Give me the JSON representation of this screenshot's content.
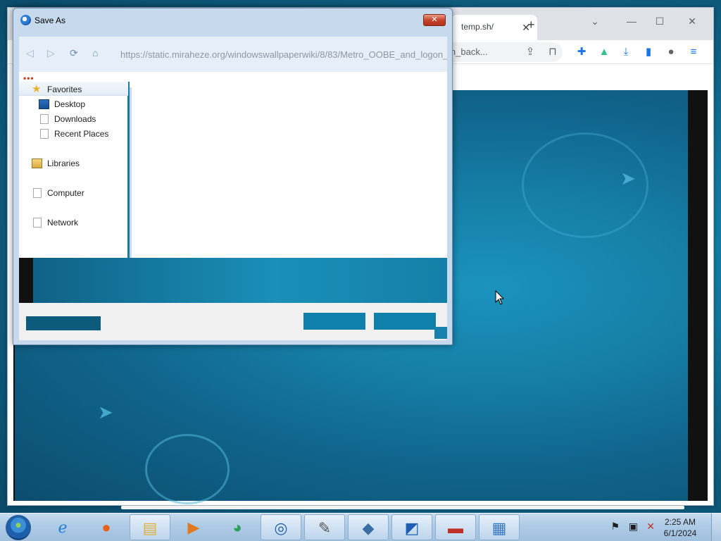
{
  "browser": {
    "tab_title": "temp.sh/",
    "address": "https://static.miraheze.org/windowswallpaperwiki/8/83/Metro_OOBE_and_logon_back...",
    "new_tab_symbol": "+",
    "tab_close_symbol": "✕"
  },
  "dialog": {
    "title": "Save As",
    "close_symbol": "✕",
    "toolbar_dots": "•••",
    "nav": {
      "favorites": "Favorites",
      "desktop": "Desktop",
      "downloads": "Downloads",
      "recent_places": "Recent Places",
      "libraries": "Libraries",
      "computer": "Computer",
      "network": "Network"
    }
  },
  "taskbar": {
    "clock_time": "2:25 AM",
    "clock_date": "6/1/2024",
    "apps": [
      "internet-explorer",
      "firefox",
      "file-explorer",
      "media-player",
      "app-green",
      "chrome",
      "pen-tool",
      "virtualbox",
      "ntlite",
      "toolbox",
      "control-panel"
    ]
  },
  "colors": {
    "wallpaper": "#147aa0",
    "dialog_frame": "#c7d9ec",
    "close_red": "#c6462d",
    "taskbar": "#aecbe6"
  }
}
